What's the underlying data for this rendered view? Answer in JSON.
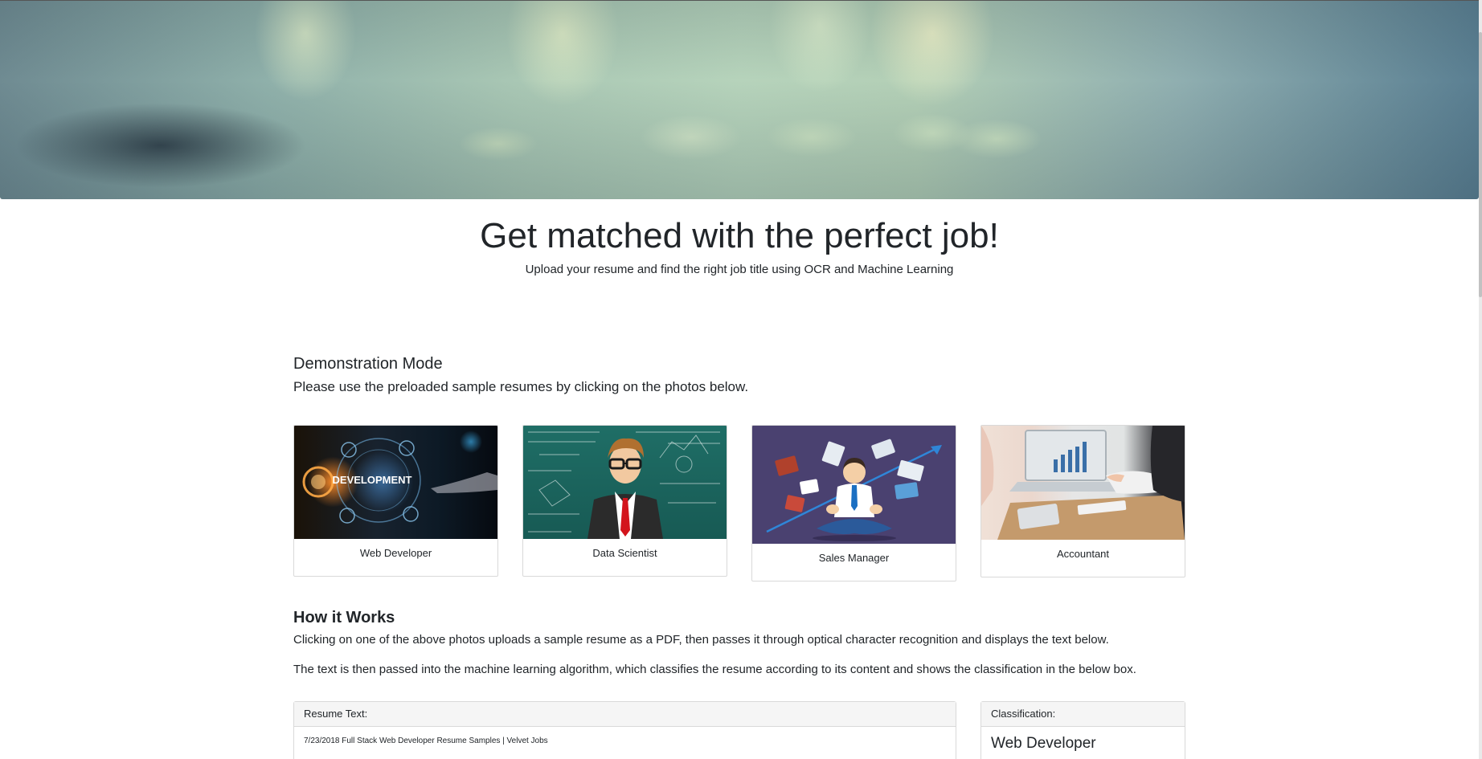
{
  "hero": {
    "image": "blurred-office-background"
  },
  "headline": "Get matched with the perfect job!",
  "subheadline": "Upload your resume and find the right job title using OCR and Machine Learning",
  "demo": {
    "title": "Demonstration Mode",
    "description": "Please use the preloaded sample resumes by clicking on the photos below.",
    "cards": [
      {
        "label": "Web Developer",
        "image": "web-development-image",
        "image_text": "DEVELOPMENT"
      },
      {
        "label": "Data Scientist",
        "image": "data-scientist-image"
      },
      {
        "label": "Sales Manager",
        "image": "sales-manager-image"
      },
      {
        "label": "Accountant",
        "image": "accountant-image"
      }
    ]
  },
  "how": {
    "title": "How it Works",
    "p1": "Clicking on one of the above photos uploads a sample resume as a PDF, then passes it through optical character recognition and displays the text below.",
    "p2": "The text is then passed into the machine learning algorithm, which classifies the resume according to its content and shows the classification in the below box."
  },
  "resume_panel": {
    "header": "Resume Text:",
    "text": "7/23/2018 Full Stack Web Developer Resume Samples | Velvet Jobs"
  },
  "classification_panel": {
    "header": "Classification:",
    "value": "Web Developer"
  },
  "colors": {
    "text": "#212529",
    "panel_header_bg": "#f5f5f5",
    "border": "#d9d9d9",
    "sales_bg": "#4a4170",
    "chalkboard": "#1f6e66"
  }
}
